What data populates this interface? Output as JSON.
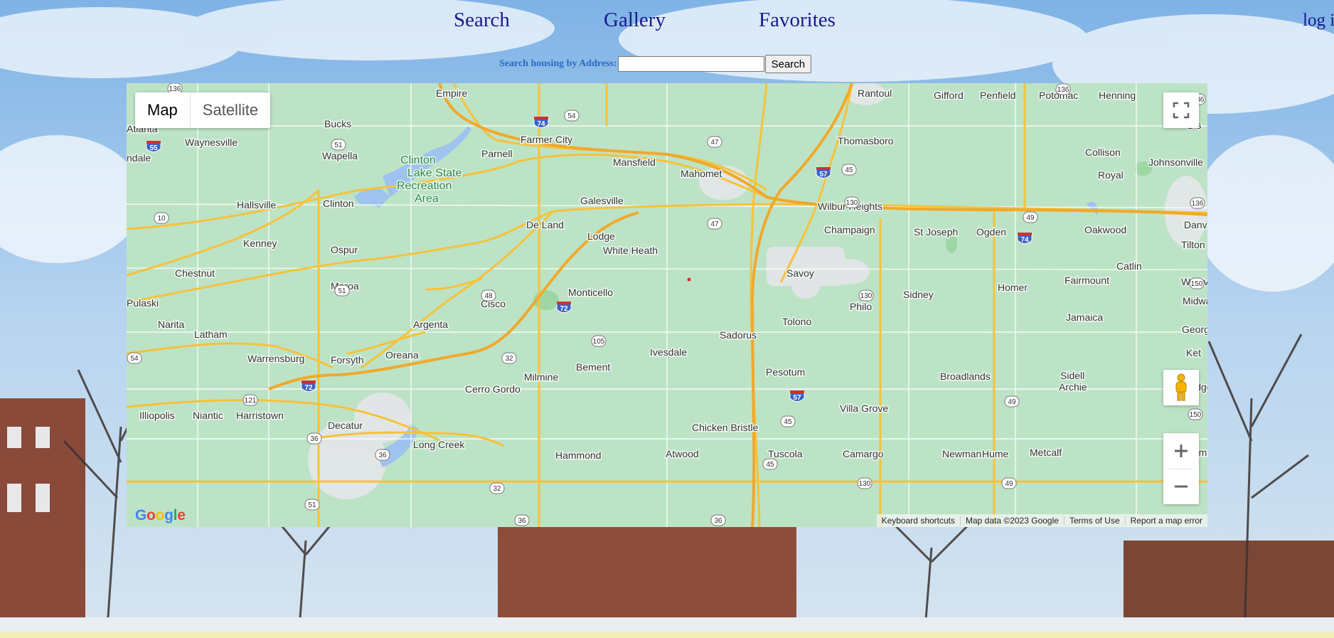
{
  "nav": {
    "search": "Search",
    "gallery": "Gallery",
    "favorites": "Favorites",
    "login": "log i"
  },
  "address_search": {
    "label": "Search housing by Address:",
    "input_value": "",
    "button": "Search"
  },
  "map": {
    "type_controls": {
      "map": "Map",
      "satellite": "Satellite"
    },
    "icons": {
      "fullscreen": "fullscreen-icon",
      "pegman": "pegman-icon",
      "zoom_in": "zoom-in-icon",
      "zoom_out": "zoom-out-icon"
    },
    "logo": "Google",
    "attribution": {
      "shortcuts": "Keyboard shortcuts",
      "data": "Map data ©2023 Google",
      "terms": "Terms of Use",
      "report": "Report a map error"
    },
    "park": [
      "Clinton",
      "Lake State",
      "Recreation",
      "Area"
    ],
    "places": [
      "Empire",
      "Bucks",
      "Atlanta",
      "Waynesville",
      "Wapella",
      "Farmer City",
      "Parnell",
      "Mansfield",
      "Mahomet",
      "Rantoul",
      "Gifford",
      "Penfield",
      "Potomac",
      "Henning",
      "Thomasboro",
      "Collison",
      "Johnsonville",
      "Royal",
      "Hallsville",
      "Clinton",
      "Galesville",
      "Wilbur Heights",
      "De Land",
      "Lodge",
      "Champaign",
      "St Joseph",
      "Ogden",
      "Oakwood",
      "Danv",
      "Kenney",
      "Ospur",
      "White Heath",
      "Tilton",
      "Chestnut",
      "Savoy",
      "Catlin",
      "Westvi",
      "Maroa",
      "Monticello",
      "Sidney",
      "Homer",
      "Fairmount",
      "Pulaski",
      "Cisco",
      "Philo",
      "Midwa",
      "Narita",
      "Argenta",
      "Tolono",
      "Jamaica",
      "Latham",
      "Sadorus",
      "Georget",
      "Warrensburg",
      "Forsyth",
      "Ivesdale",
      "Oreana",
      "Bement",
      "Pesotum",
      "Broadlands",
      "Sidell",
      "Archie",
      "Milmine",
      "Cerro Gordo",
      "Illiopolis",
      "Niantic",
      "Harristown",
      "Decatur",
      "Villa Grove",
      "Chicken Bristle",
      "Long Creek",
      "Hammond",
      "Atwood",
      "Tuscola",
      "Camargo",
      "Newman",
      "Hume",
      "Metcalf",
      "Chrisman",
      "ndale",
      "Bis",
      "Ridge Far",
      "Ket"
    ],
    "shields": [
      "136",
      "55",
      "51",
      "74",
      "54",
      "47",
      "57",
      "45",
      "136",
      "10",
      "49",
      "74",
      "150",
      "51",
      "48",
      "72",
      "105",
      "32",
      "121",
      "54",
      "72",
      "36",
      "36",
      "45",
      "57",
      "130",
      "49",
      "150",
      "45",
      "130",
      "49",
      "32",
      "36",
      "36",
      "51",
      "136",
      "136",
      "130",
      "47"
    ]
  }
}
